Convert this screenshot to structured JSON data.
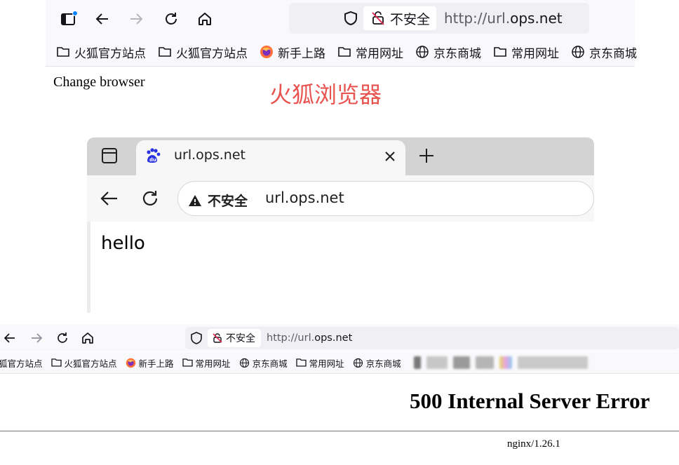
{
  "top_browser": {
    "security_label": "不安全",
    "url_prefix": "http://url.",
    "url_host": "ops.net",
    "bookmarks": [
      {
        "label": "火狐官方站点",
        "icon": "folder-icon"
      },
      {
        "label": "火狐官方站点",
        "icon": "folder-icon"
      },
      {
        "label": "新手上路",
        "icon": "firefox-icon"
      },
      {
        "label": "常用网址",
        "icon": "folder-icon"
      },
      {
        "label": "京东商城",
        "icon": "globe-icon"
      },
      {
        "label": "常用网址",
        "icon": "folder-icon"
      },
      {
        "label": "京东商城",
        "icon": "globe-icon"
      }
    ]
  },
  "notes": {
    "change_browser": "Change browser",
    "firefox_caption": "火狐浏览器"
  },
  "chrome_window": {
    "tab_title": "url.ops.net",
    "security_label": "不安全",
    "url": "url.ops.net",
    "page_text": "hello"
  },
  "bottom_browser": {
    "security_label": "不安全",
    "url_prefix": "http://url.",
    "url_host": "ops.net",
    "bookmarks": [
      {
        "label": "狐官方站点",
        "icon": "none"
      },
      {
        "label": "火狐官方站点",
        "icon": "folder-icon"
      },
      {
        "label": "新手上路",
        "icon": "firefox-icon"
      },
      {
        "label": "常用网址",
        "icon": "folder-icon"
      },
      {
        "label": "京东商城",
        "icon": "globe-icon"
      },
      {
        "label": "常用网址",
        "icon": "folder-icon"
      },
      {
        "label": "京东商城",
        "icon": "globe-icon"
      }
    ]
  },
  "error_page": {
    "title": "500 Internal Server Error",
    "server": "nginx/1.26.1"
  },
  "colors": {
    "accent_red": "#e8534f",
    "baidu_blue": "#2932e1",
    "sidebar_dot": "#0a84ff"
  }
}
